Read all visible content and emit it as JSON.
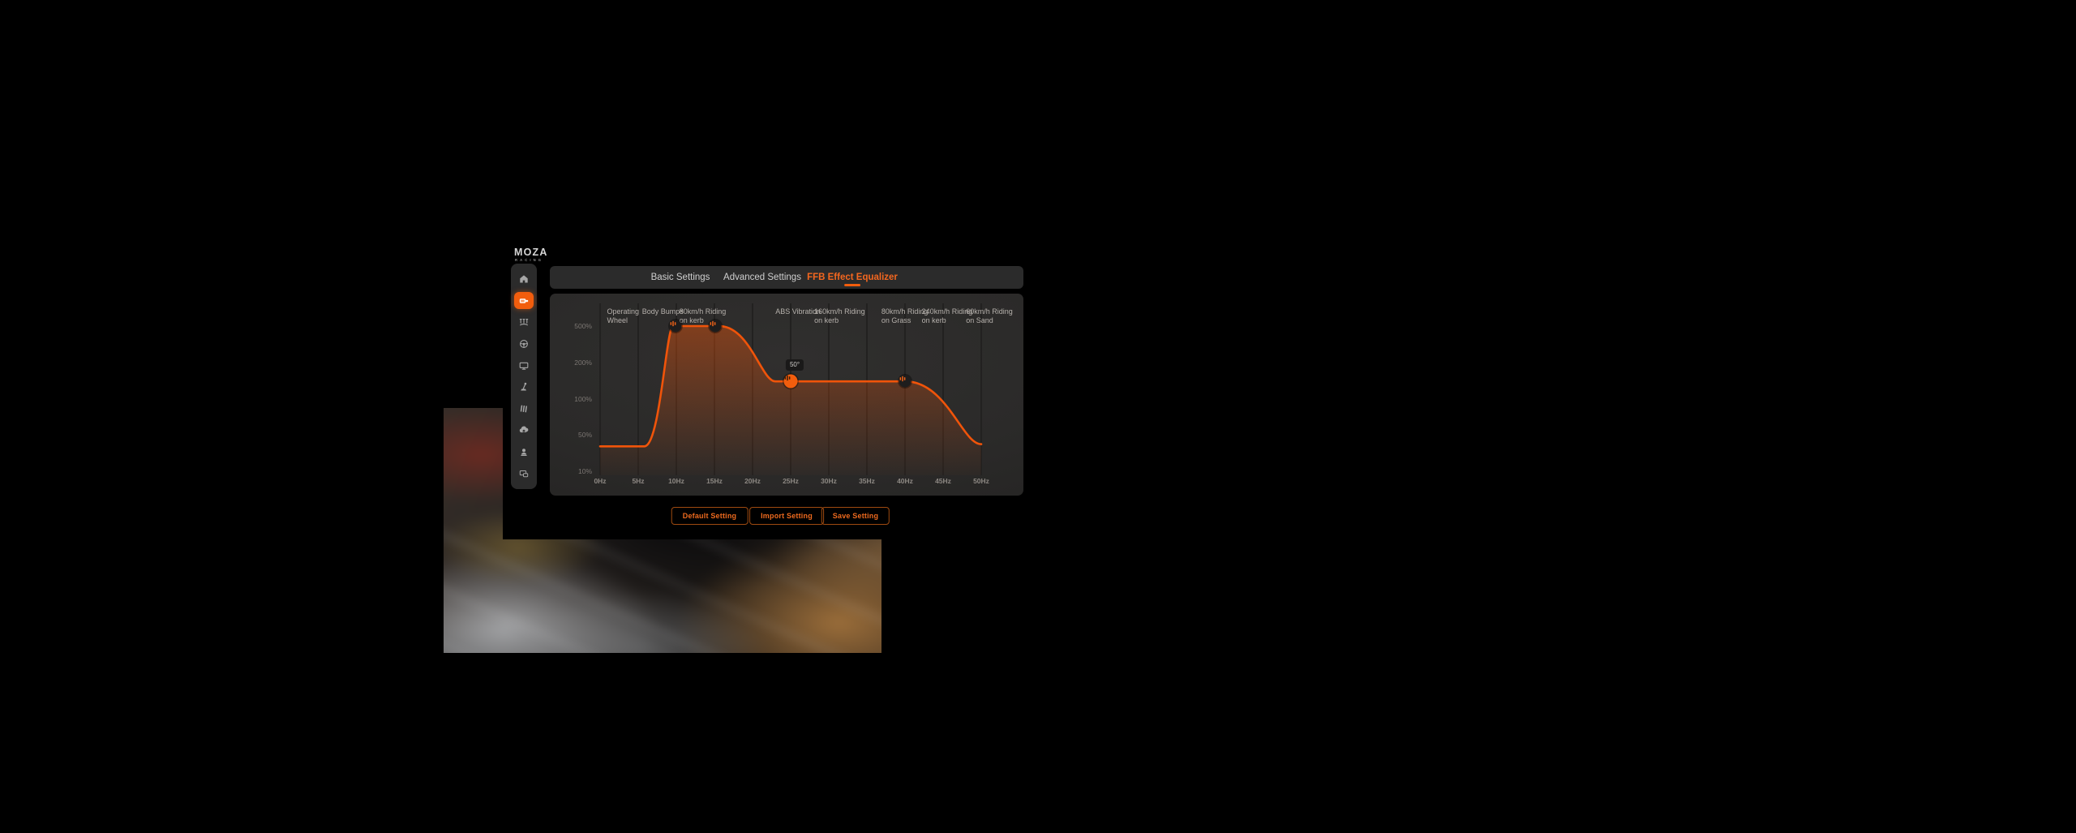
{
  "brand": {
    "name": "MOZA",
    "sub": "RACING"
  },
  "tabs": {
    "basic": "Basic Settings",
    "advanced": "Advanced Settings",
    "ffb": "FFB Effect Equalizer"
  },
  "sidebar": {
    "items": [
      "home",
      "wheelbase",
      "pedals",
      "steering-wheel",
      "display",
      "shifter",
      "library",
      "cloud-sync",
      "profile",
      "devices"
    ],
    "active_index": 1,
    "accent_color": "#f25d0d"
  },
  "chart_data": {
    "type": "line",
    "title": "FFB Effect Equalizer",
    "x_unit": "Hz",
    "x_range_hz": [
      0,
      50
    ],
    "x_ticks": [
      "0Hz",
      "5Hz",
      "10Hz",
      "15Hz",
      "20Hz",
      "25Hz",
      "30Hz",
      "35Hz",
      "40Hz",
      "45Hz",
      "50Hz"
    ],
    "y_ticks": [
      "500%",
      "200%",
      "100%",
      "50%",
      "10%"
    ],
    "y_tick_values": [
      500,
      200,
      100,
      50,
      10
    ],
    "band_labels": [
      {
        "hz": 0.9,
        "lines": [
          "Operating",
          "Wheel"
        ]
      },
      {
        "hz": 5.5,
        "lines": [
          "Body Bumps"
        ]
      },
      {
        "hz": 10.4,
        "lines": [
          "80km/h Riding",
          "on kerb"
        ]
      },
      {
        "hz": 23.0,
        "lines": [
          "ABS Vibration"
        ]
      },
      {
        "hz": 28.1,
        "lines": [
          "160km/h Riding",
          "on kerb"
        ]
      },
      {
        "hz": 36.9,
        "lines": [
          "80km/h Riding",
          "on Grass"
        ]
      },
      {
        "hz": 42.2,
        "lines": [
          "240km/h Riding",
          "on kerb"
        ]
      },
      {
        "hz": 48.0,
        "lines": [
          "60km/h Riding",
          "on Sand"
        ]
      }
    ],
    "curve": [
      {
        "hz": 0,
        "pct": 30
      },
      {
        "hz": 5.8,
        "pct": 30
      },
      {
        "hz": 9.6,
        "pct": 500
      },
      {
        "hz": 15.6,
        "pct": 500
      },
      {
        "hz": 23,
        "pct": 140
      },
      {
        "hz": 40,
        "pct": 140
      },
      {
        "hz": 50,
        "pct": 33
      }
    ],
    "handles": [
      {
        "hz": 9.9,
        "pct": 500,
        "active": false
      },
      {
        "hz": 15.1,
        "pct": 500,
        "active": false
      },
      {
        "hz": 25,
        "pct": 140,
        "active": true,
        "tooltip": "50°"
      },
      {
        "hz": 40,
        "pct": 140,
        "active": false
      }
    ],
    "line_color": "#f0540a",
    "fill_top_color": "rgba(242,86,10,0.42)",
    "fill_bottom_color": "rgba(242,86,10,0.02)",
    "grid_color": "#222120",
    "legend": "none",
    "grid": "vertical-only"
  },
  "buttons": {
    "default": "Default Setting",
    "import": "Import Setting",
    "save": "Save Setting"
  }
}
